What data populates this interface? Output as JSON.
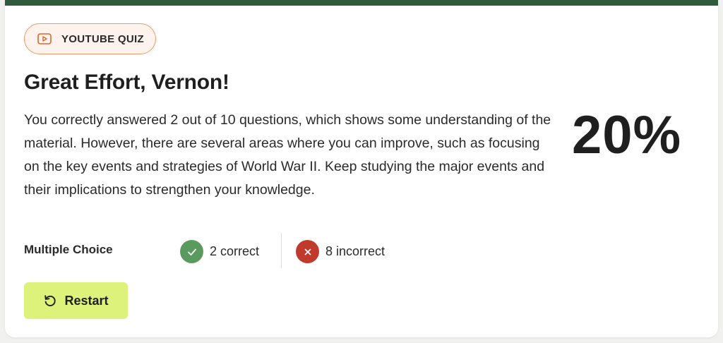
{
  "badge": {
    "label": "YOUTUBE QUIZ",
    "icon": "play-icon"
  },
  "result": {
    "title": "Great Effort, Vernon!",
    "summary": "You correctly answered 2 out of 10 questions, which shows some understanding of the material. However, there are several areas where you can improve, such as focusing on the key events and strategies of World War II. Keep studying the major events and their implications to strengthen your knowledge.",
    "score": "20%"
  },
  "stats": {
    "label": "Multiple Choice",
    "correct": {
      "text": "2 correct",
      "icon": "check-icon",
      "color": "#5b9a5f"
    },
    "incorrect": {
      "text": "8 incorrect",
      "icon": "x-icon",
      "color": "#c0392b"
    }
  },
  "actions": {
    "restart_label": "Restart",
    "restart_icon": "restart-icon"
  },
  "colors": {
    "accent_bar": "#2f5a3c",
    "badge_border": "#e99a6c",
    "badge_bg": "#fdf3ec",
    "restart_bg": "#dcf27a"
  }
}
